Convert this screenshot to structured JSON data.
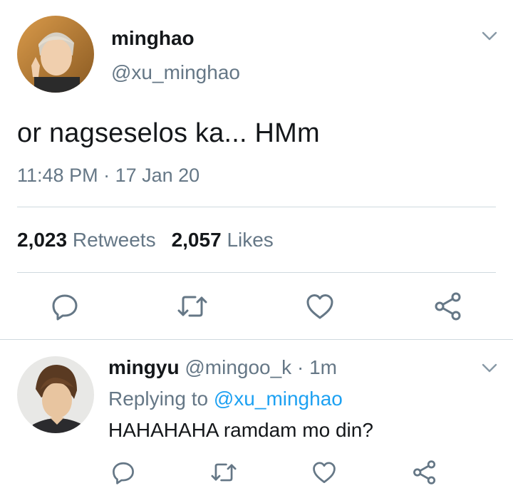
{
  "tweet": {
    "display_name": "minghao",
    "handle": "@xu_minghao",
    "text": "or nagseselos ka... HMm",
    "time": "11:48 PM",
    "separator": " · ",
    "date": "17 Jan 20",
    "retweets_count": "2,023",
    "retweets_label": "Retweets",
    "likes_count": "2,057",
    "likes_label": "Likes",
    "actions": [
      "reply-icon",
      "retweet-icon",
      "like-icon",
      "share-icon"
    ]
  },
  "reply": {
    "display_name": "mingyu",
    "handle": "@mingoo_k",
    "dot": " · ",
    "time": "1m",
    "replying_prefix": "Replying to ",
    "replying_to": "@xu_minghao",
    "text": "HAHAHAHA ramdam mo din?",
    "actions": [
      "reply-icon",
      "retweet-icon",
      "like-icon",
      "share-icon"
    ]
  },
  "colors": {
    "text": "#14171a",
    "secondary": "#657786",
    "link": "#1da1f2",
    "divider": "#cfd9de"
  }
}
